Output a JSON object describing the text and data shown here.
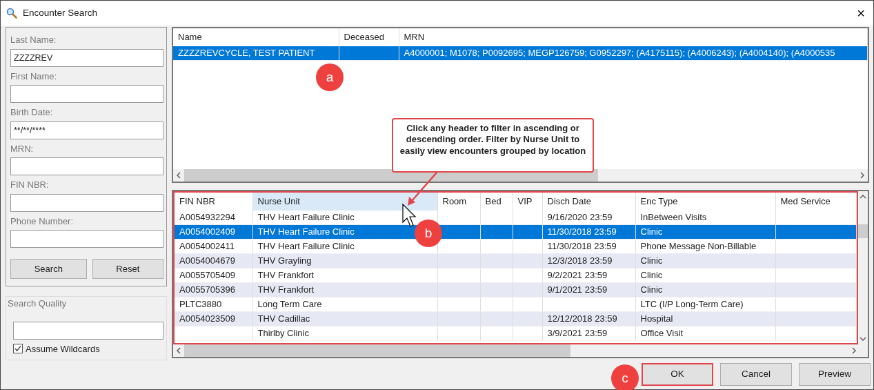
{
  "window": {
    "title": "Encounter Search",
    "close": "×"
  },
  "search_form": {
    "fields": [
      {
        "label": "Last Name:",
        "value": "ZZZZREV"
      },
      {
        "label": "First Name:"
      },
      {
        "label": "Birth Date:",
        "value": "**/**/****"
      },
      {
        "label": "MRN:"
      },
      {
        "label": "FIN NBR:"
      },
      {
        "label": "Phone Number:"
      }
    ],
    "buttons": [
      "Search",
      "Reset"
    ]
  },
  "search_quality": {
    "title": "Search Quality",
    "assume_wildcards": {
      "label": "Assume Wildcards",
      "checked": true
    }
  },
  "patients": {
    "columns": [
      "Name",
      "Deceased",
      "MRN"
    ],
    "rows": [
      {
        "selected": true,
        "cells": [
          "ZZZZREVCYCLE, TEST PATIENT",
          "",
          "A4000001; M1078; P0092695; MEGP126759; G0952297; (A4175115); (A4006243); (A4004140); (A4000535"
        ]
      }
    ]
  },
  "encounters": {
    "columns": [
      {
        "label": "FIN NBR",
        "hovered": false
      },
      {
        "label": "Nurse Unit",
        "hovered": true
      },
      {
        "label": "Room",
        "hovered": false
      },
      {
        "label": "Bed",
        "hovered": false
      },
      {
        "label": "VIP",
        "hovered": false
      },
      {
        "label": "Disch Date",
        "hovered": false
      },
      {
        "label": "Enc Type",
        "hovered": false
      },
      {
        "label": "Med Service",
        "hovered": false
      }
    ],
    "rows": [
      {
        "selected": false,
        "cells": [
          "A0054932294",
          "THV Heart Failure Clinic",
          "",
          "",
          "",
          "9/16/2020 23:59",
          "InBetween Visits",
          ""
        ]
      },
      {
        "selected": true,
        "cells": [
          "A0054002409",
          "THV Heart Failure Clinic",
          "",
          "",
          "",
          "11/30/2018 23:59",
          "Clinic",
          ""
        ]
      },
      {
        "selected": false,
        "cells": [
          "A0054002411",
          "THV Heart Failure Clinic",
          "",
          "",
          "",
          "11/30/2018 23:59",
          "Phone Message Non-Billable",
          ""
        ]
      },
      {
        "selected": false,
        "cells": [
          "A0054004679",
          "THV Grayling",
          "",
          "",
          "",
          "12/3/2018 23:59",
          "Clinic",
          ""
        ]
      },
      {
        "selected": false,
        "cells": [
          "A0055705409",
          "THV Frankfort",
          "",
          "",
          "",
          "9/2/2021 23:59",
          "Clinic",
          ""
        ]
      },
      {
        "selected": false,
        "cells": [
          "A0055705396",
          "THV Frankfort",
          "",
          "",
          "",
          "9/1/2021 23:59",
          "Clinic",
          ""
        ]
      },
      {
        "selected": false,
        "cells": [
          "PLTC3880",
          "Long Term Care",
          "",
          "",
          "",
          "",
          "LTC (I/P Long-Term Care)",
          ""
        ]
      },
      {
        "selected": false,
        "cells": [
          "A0054023509",
          "THV Cadillac",
          "",
          "",
          "",
          "12/12/2018 23:59",
          "Hospital",
          ""
        ]
      },
      {
        "selected": false,
        "cells": [
          "",
          "Thirlby Clinic",
          "",
          "",
          "",
          "3/9/2021 23:59",
          "Office Visit",
          ""
        ]
      }
    ]
  },
  "callout": {
    "text": "Click any header to filter in ascending or descending order. Filter by Nurse Unit to easily view encounters grouped by location"
  },
  "markers": [
    "a",
    "b",
    "c"
  ],
  "dialog_buttons": [
    {
      "label": "OK",
      "highlighted": true
    },
    {
      "label": "Cancel",
      "highlighted": false
    },
    {
      "label": "Preview",
      "highlighted": false
    }
  ]
}
